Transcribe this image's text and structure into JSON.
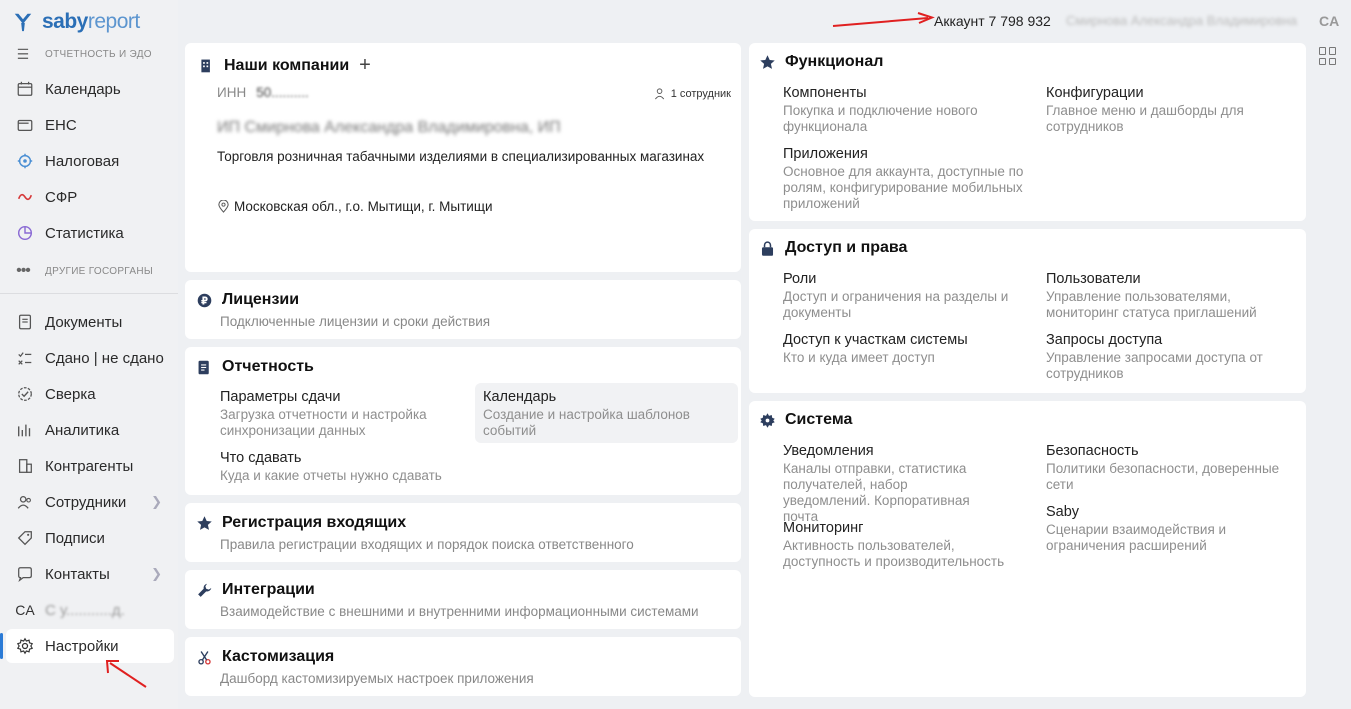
{
  "app": {
    "brand_bold": "saby",
    "brand_light": "report"
  },
  "sidebar": {
    "section1": "Отчетность и ЭДО",
    "items1": [
      {
        "label": "Календарь"
      },
      {
        "label": "ЕНС"
      },
      {
        "label": "Налоговая"
      },
      {
        "label": "СФР"
      },
      {
        "label": "Статистика"
      }
    ],
    "section2": "Другие госорганы",
    "items2": [
      {
        "label": "Документы"
      },
      {
        "label": "Сдано | не сдано"
      },
      {
        "label": "Сверка"
      },
      {
        "label": "Аналитика"
      },
      {
        "label": "Контрагенты"
      },
      {
        "label": "Сотрудники"
      },
      {
        "label": "Подписи"
      },
      {
        "label": "Контакты"
      }
    ],
    "user_initials": "CA",
    "user_name": "С у...........д.",
    "settings": "Настройки"
  },
  "topbar": {
    "account": "Аккаунт 7 798 932",
    "account_name": "Смирнова Александра Владимировна",
    "user_initials": "CA"
  },
  "companies": {
    "title": "Наши компании",
    "plus": "+",
    "inn_label": "ИНН",
    "inn_value": "50..........",
    "employees": "1 сотрудник",
    "name": "ИП Смирнова Александра Владимировна, ИП",
    "activity": "Торговля розничная табачными изделиями в специализированных магазинах",
    "address": "Московская обл., г.о. Мытищи, г. Мытищи"
  },
  "licenses": {
    "title": "Лицензии",
    "subtitle": "Подключенные лицензии и сроки действия"
  },
  "reporting": {
    "title": "Отчетность",
    "entries": [
      {
        "title": "Параметры сдачи",
        "desc": "Загрузка отчетности и настройка синхронизации данных"
      },
      {
        "title": "Календарь",
        "desc": "Создание и настройка шаблонов событий"
      },
      {
        "title": "Что сдавать",
        "desc": "Куда и какие отчеты нужно сдавать"
      }
    ]
  },
  "registration": {
    "title": "Регистрация входящих",
    "subtitle": "Правила регистрации входящих и порядок поиска ответственного"
  },
  "integrations": {
    "title": "Интеграции",
    "subtitle": "Взаимодействие с внешними и внутренними информационными системами"
  },
  "customization": {
    "title": "Кастомизация",
    "subtitle": "Дашборд кастомизируемых настроек приложения"
  },
  "functional": {
    "title": "Функционал",
    "entries": [
      {
        "title": "Компоненты",
        "desc": "Покупка и подключение нового функционала"
      },
      {
        "title": "Конфигурации",
        "desc": "Главное меню и дашборды для сотрудников"
      },
      {
        "title": "Приложения",
        "desc": "Основное для аккаунта, доступные по ролям, конфигурирование мобильных приложений"
      }
    ]
  },
  "access": {
    "title": "Доступ и права",
    "entries": [
      {
        "title": "Роли",
        "desc": "Доступ и ограничения на разделы и документы"
      },
      {
        "title": "Пользователи",
        "desc": "Управление пользователями, мониторинг статуса приглашений"
      },
      {
        "title": "Доступ к участкам системы",
        "desc": "Кто и куда имеет доступ"
      },
      {
        "title": "Запросы доступа",
        "desc": "Управление запросами доступа от сотрудников"
      }
    ]
  },
  "system": {
    "title": "Система",
    "entries": [
      {
        "title": "Уведомления",
        "desc": "Каналы отправки, статистика получателей, набор уведомлений. Корпоративная почта"
      },
      {
        "title": "Безопасность",
        "desc": "Политики безопасности, доверенные сети"
      },
      {
        "title": "Мониторинг",
        "desc": "Активность пользователей, доступность и производительность"
      },
      {
        "title": "Saby",
        "desc": "Сценарии взаимодействия и ограничения расширений"
      }
    ]
  },
  "colors": {
    "accent": "#2b7bd6",
    "annotation": "#e02020",
    "brand": "#2b6fb6"
  }
}
